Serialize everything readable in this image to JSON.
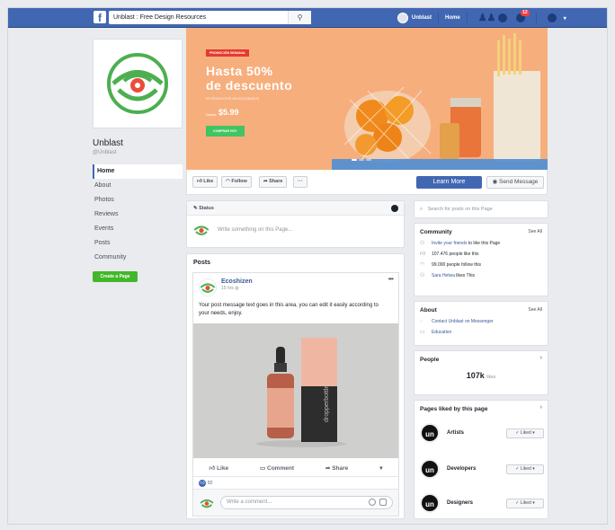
{
  "topbar": {
    "fb_logo": "f",
    "search_value": "Unblast : Free Design Resources",
    "search_icon": "search-icon",
    "user_name": "Unblast",
    "home_label": "Home",
    "notification_badge": "12"
  },
  "page": {
    "name": "Unblast",
    "handle": "@Unblast",
    "brand_color": "#4caf50"
  },
  "nav": {
    "items": [
      {
        "label": "Home"
      },
      {
        "label": "About"
      },
      {
        "label": "Photos"
      },
      {
        "label": "Reviews"
      },
      {
        "label": "Events"
      },
      {
        "label": "Posts"
      },
      {
        "label": "Community"
      }
    ],
    "create_page": "Create a Page"
  },
  "cover": {
    "tag": "PROMOCIÓN SEMANAL",
    "title_line1": "Hasta 50%",
    "title_line2": "de descuento",
    "subtitle": "EN PRODUCTOS SELECCIONADOS",
    "price_label": "Desde",
    "price": "$5.99",
    "button": "COMPRAR HOY"
  },
  "actions": {
    "like": "Like",
    "follow": "Follow",
    "share": "Share",
    "more": "···",
    "learn_more": "Learn More",
    "send_message": "Send Message"
  },
  "status": {
    "title": "Status",
    "placeholder": "Write something on this Page..."
  },
  "posts": {
    "heading": "Posts",
    "author": "Ecoshizen",
    "time": "15 hrs",
    "text": "Your post message text goes in this area, you can edit it easily according to your needs, enjoy.",
    "like": "Like",
    "comment": "Comment",
    "share": "Share",
    "reactions_count": "82",
    "comment_placeholder": "Write a comment...",
    "product_label": "dropperbottle"
  },
  "right": {
    "search_placeholder": "Search for posts on this Page",
    "community": {
      "title": "Community",
      "see_all": "See All",
      "invite_link": "Invite your friends",
      "invite_rest": " to like this Page",
      "likes": "107.476 people like this",
      "follows": "99.000 people follow this",
      "friend_link": "Sara Helwa",
      "friend_rest": " likes This"
    },
    "about": {
      "title": "About",
      "see_all": "See All",
      "messenger": "Contact Unblast on Messenger",
      "education": "Education"
    },
    "people": {
      "title": "People",
      "count": "107k",
      "count_suffix": "likes"
    },
    "pages_liked": {
      "title": "Pages liked by this page",
      "items": [
        {
          "name": "Artists",
          "button": "✓ Liked ▾"
        },
        {
          "name": "Developers",
          "button": "✓ Liked ▾"
        },
        {
          "name": "Designers",
          "button": "✓ Liked ▾"
        }
      ],
      "logo_text": "un"
    }
  }
}
